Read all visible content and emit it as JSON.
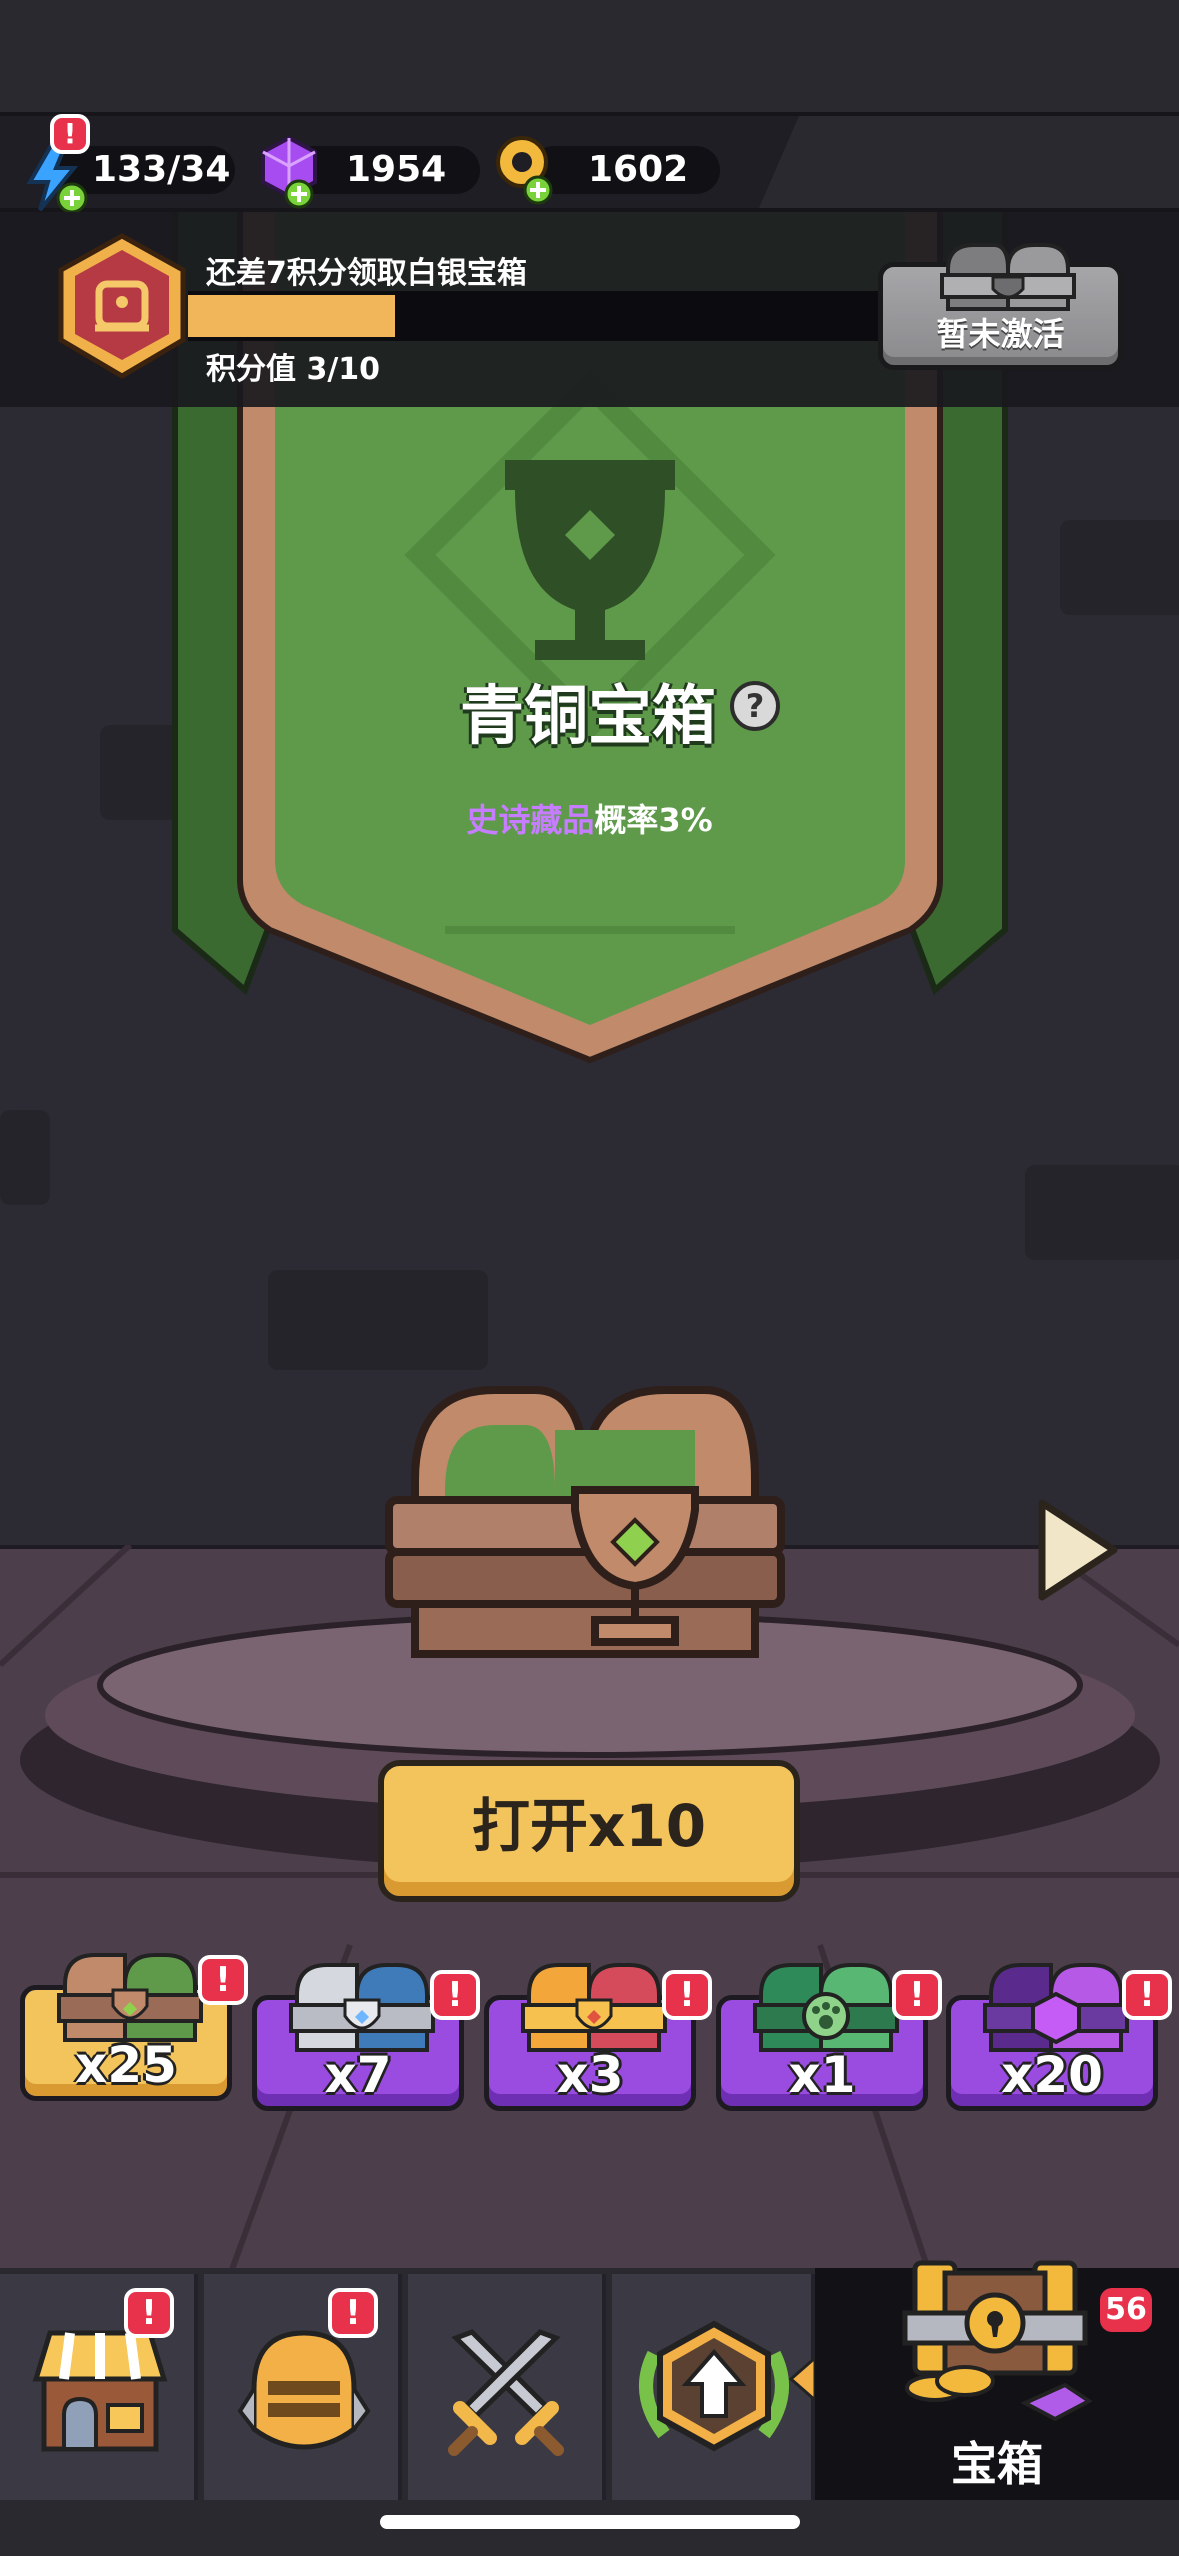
{
  "resources": {
    "energy": {
      "icon": "lightning-icon",
      "value": "133/34"
    },
    "gems": {
      "icon": "gem-icon",
      "value": "1954"
    },
    "keys": {
      "icon": "key-icon",
      "value": "1602"
    }
  },
  "progress": {
    "message": "还差7积分领取白银宝箱",
    "points_label": "积分值 3/10",
    "fraction": 0.3,
    "badge_icon": "rank-badge-icon",
    "next_reward_button": "暂未激活"
  },
  "banner": {
    "title": "青铜宝箱",
    "help": "?",
    "odds_epic": "史诗藏品",
    "odds_rest": "概率3%",
    "color": "#5f9a4b"
  },
  "open_button": {
    "label": "打开x10"
  },
  "chest_tabs": [
    {
      "name": "bronze",
      "count": "x25",
      "active": true,
      "icon": "bronze-chest-icon"
    },
    {
      "name": "silver",
      "count": "x7",
      "active": false,
      "icon": "silver-chest-icon"
    },
    {
      "name": "gold",
      "count": "x3",
      "active": false,
      "icon": "gold-chest-icon"
    },
    {
      "name": "pet",
      "count": "x1",
      "active": false,
      "icon": "pet-chest-icon"
    },
    {
      "name": "gem",
      "count": "x20",
      "active": false,
      "icon": "gem-chest-icon"
    }
  ],
  "alert_mark": "!",
  "bottom_nav": {
    "items": [
      {
        "icon": "shop-icon"
      },
      {
        "icon": "helmet-icon"
      },
      {
        "icon": "crossed-swords-icon"
      },
      {
        "icon": "upgrade-icon"
      }
    ],
    "chest": {
      "label": "宝箱",
      "count": "56",
      "icon": "treasure-chest-icon"
    }
  },
  "colors": {
    "accent": "#f4c45c",
    "alert": "#e8314b",
    "purple": "#9a4be0"
  }
}
